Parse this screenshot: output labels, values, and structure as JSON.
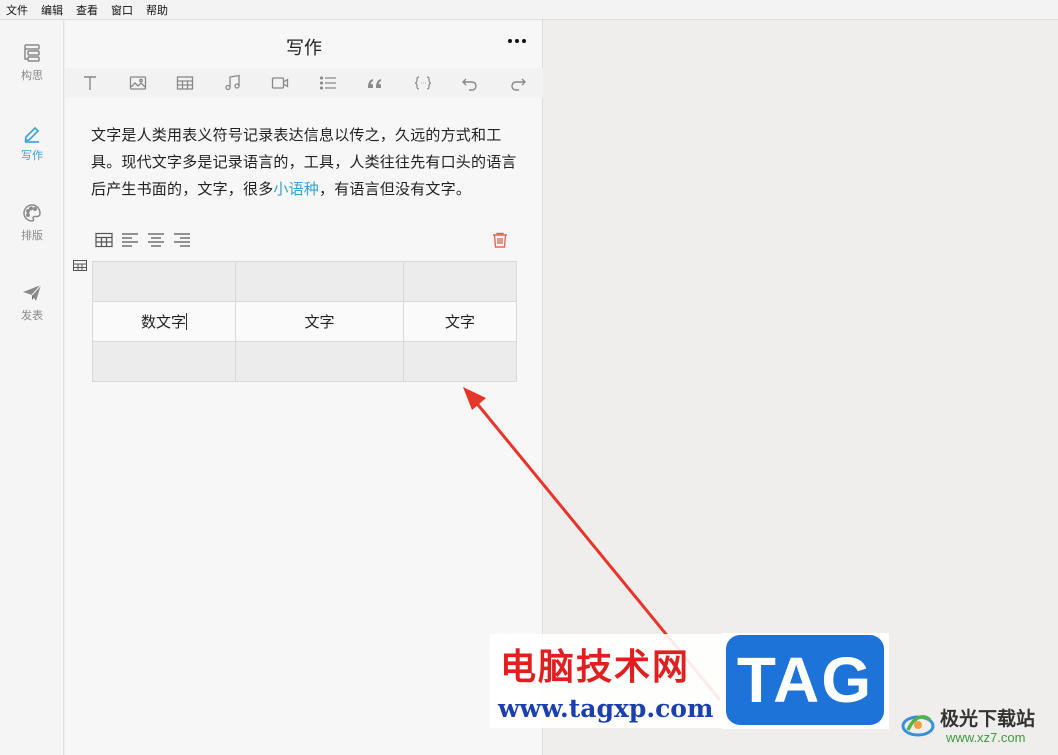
{
  "menu": [
    "文件",
    "编辑",
    "查看",
    "窗口",
    "帮助"
  ],
  "nav": {
    "items": [
      {
        "label": "构思",
        "icon": "outline-icon"
      },
      {
        "label": "写作",
        "icon": "pen-icon",
        "active": true
      },
      {
        "label": "排版",
        "icon": "palette-icon"
      },
      {
        "label": "发表",
        "icon": "paper-plane-icon"
      }
    ]
  },
  "editor": {
    "title": "写作",
    "toolbar": [
      "text-icon",
      "image-icon",
      "table-icon",
      "music-icon",
      "video-icon",
      "list-icon",
      "quote-icon",
      "code-icon",
      "undo-icon",
      "redo-icon"
    ],
    "paragraph": {
      "before_link": "文字是人类用表义符号记录表达信息以传之，久远的方式和工具。现代文字多是记录语言的，工具，人类往往先有口头的语言后产生书面的，文字，很多",
      "link": "小语种",
      "after_link": "，有语言但没有文字。"
    },
    "table": {
      "rows": [
        [
          "",
          "",
          ""
        ],
        [
          "数文字",
          "文字",
          "文字"
        ],
        [
          "",
          "",
          ""
        ]
      ]
    }
  },
  "watermarks": {
    "site_name": "电脑技术网",
    "site_url": "www.tagxp.com",
    "tag_logo": "TAG",
    "right_name": "极光下载站",
    "right_url": "www.xz7.com"
  },
  "colors": {
    "accent": "#3d9fd4",
    "arrow": "#e8352a",
    "delete": "#e06a5a"
  }
}
